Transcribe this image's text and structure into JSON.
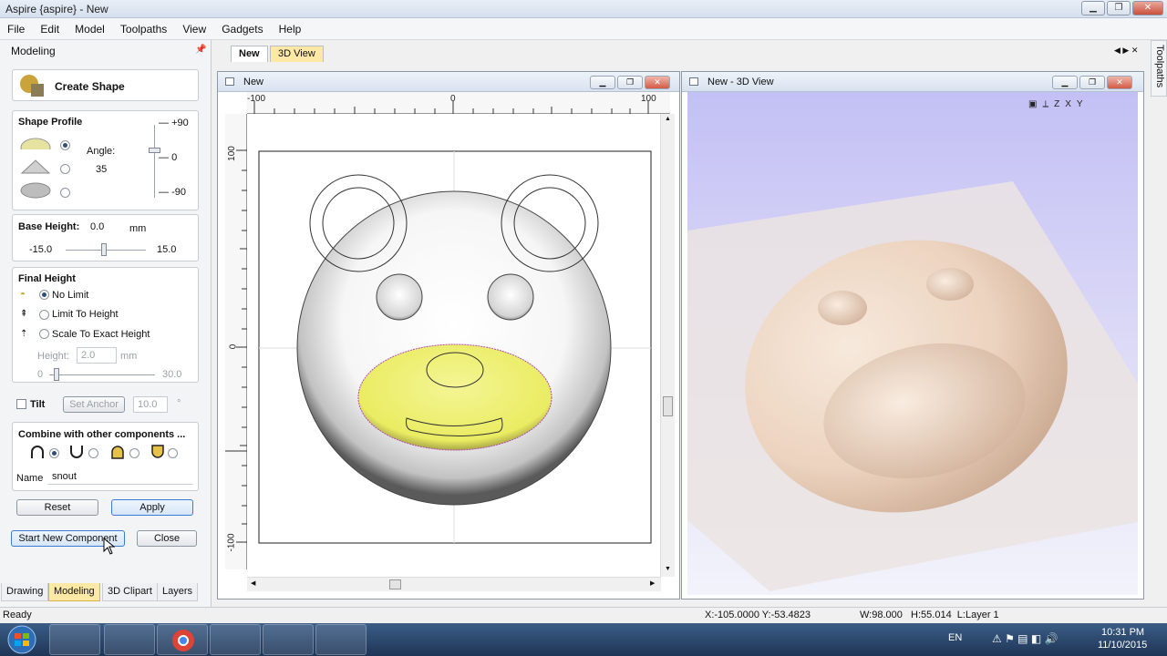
{
  "window": {
    "title": "Aspire {aspire} - New"
  },
  "menu": [
    "File",
    "Edit",
    "Model",
    "Toolpaths",
    "View",
    "Gadgets",
    "Help"
  ],
  "left_panel": {
    "header": "Modeling",
    "create_shape": "Create Shape",
    "shape_profile": {
      "title": "Shape Profile",
      "angle_label": "Angle:",
      "angle_value": "35",
      "scale_top": "+90",
      "scale_mid": "0",
      "scale_bot": "-90"
    },
    "base_height": {
      "label": "Base Height:",
      "value": "0.0",
      "unit": "mm",
      "min": "-15.0",
      "max": "15.0"
    },
    "final_height": {
      "title": "Final Height",
      "options": [
        "No Limit",
        "Limit To Height",
        "Scale To Exact Height"
      ],
      "height_label": "Height:",
      "height_value": "2.0",
      "height_unit": "mm",
      "min": "0",
      "max": "30.0"
    },
    "tilt": {
      "label": "Tilt",
      "set_anchor": "Set Anchor",
      "angle_value": "10.0",
      "degree": "°"
    },
    "combine": {
      "title": "Combine with other components ...",
      "name_label": "Name",
      "name_value": "snout"
    },
    "buttons": {
      "reset": "Reset",
      "apply": "Apply",
      "start_new": "Start New Component",
      "close": "Close"
    },
    "bottom_tabs": [
      "Drawing",
      "Modeling",
      "3D Clipart",
      "Layers"
    ]
  },
  "doc_tabs": [
    "New",
    "3D View"
  ],
  "view2d": {
    "title": "New",
    "ruler_h": [
      "-100",
      "0",
      "100"
    ],
    "ruler_v": [
      "100",
      "0",
      "-100"
    ]
  },
  "view3d": {
    "title": "New - 3D View",
    "toolbar": [
      "iso",
      "Z",
      "X",
      "Y"
    ]
  },
  "right_tab": "Toolpaths",
  "status": {
    "ready": "Ready",
    "coords": "X:-105.0000 Y:-53.4823",
    "size": "W:98.000   H:55.014  L:Layer 1"
  },
  "taskbar": {
    "lang": "EN",
    "time": "10:31 PM",
    "date": "11/10/2015"
  }
}
